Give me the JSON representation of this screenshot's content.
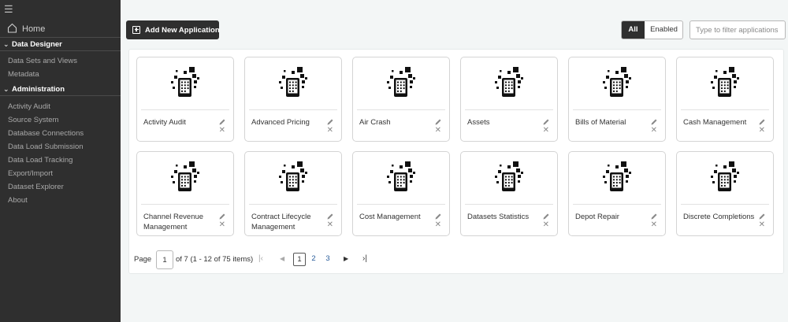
{
  "sidebar": {
    "menu_icon": "hamburger-icon",
    "home": {
      "label": "Home",
      "icon": "home-icon"
    },
    "sections": [
      {
        "label": "Data Designer",
        "items": [
          "Data Sets and Views",
          "Metadata"
        ]
      },
      {
        "label": "Administration",
        "items": [
          "Activity Audit",
          "Source System",
          "Database Connections",
          "Data Load Submission",
          "Data Load Tracking",
          "Export/Import",
          "Dataset Explorer",
          "About"
        ]
      }
    ]
  },
  "toolbar": {
    "add_label": "Add New Application",
    "filter_all": "All",
    "filter_enabled": "Enabled",
    "filter_all_selected": true,
    "search_placeholder": "Type to filter applications",
    "search_value": ""
  },
  "applications": [
    {
      "name": "Activity Audit"
    },
    {
      "name": "Advanced Pricing"
    },
    {
      "name": "Air Crash"
    },
    {
      "name": "Assets"
    },
    {
      "name": "Bills of Material"
    },
    {
      "name": "Cash Management"
    },
    {
      "name": "Channel Revenue Management"
    },
    {
      "name": "Contract Lifecycle Management"
    },
    {
      "name": "Cost Management"
    },
    {
      "name": "Datasets Statistics"
    },
    {
      "name": "Depot Repair"
    },
    {
      "name": "Discrete Completions"
    }
  ],
  "pagination": {
    "page_label": "Page",
    "current_page": "1",
    "info": "of 7 (1 - 12 of 75 items)",
    "pages": [
      "1",
      "2",
      "3"
    ],
    "first_icon": "first-page-icon",
    "prev_icon": "previous-page-icon",
    "next_icon": "next-page-icon",
    "last_icon": "last-page-icon"
  },
  "colors": {
    "sidebar_bg": "#2f2f2f",
    "page_bg": "#f3f6f6",
    "accent_dark": "#2f2f2f",
    "link": "#2a5d9b"
  }
}
